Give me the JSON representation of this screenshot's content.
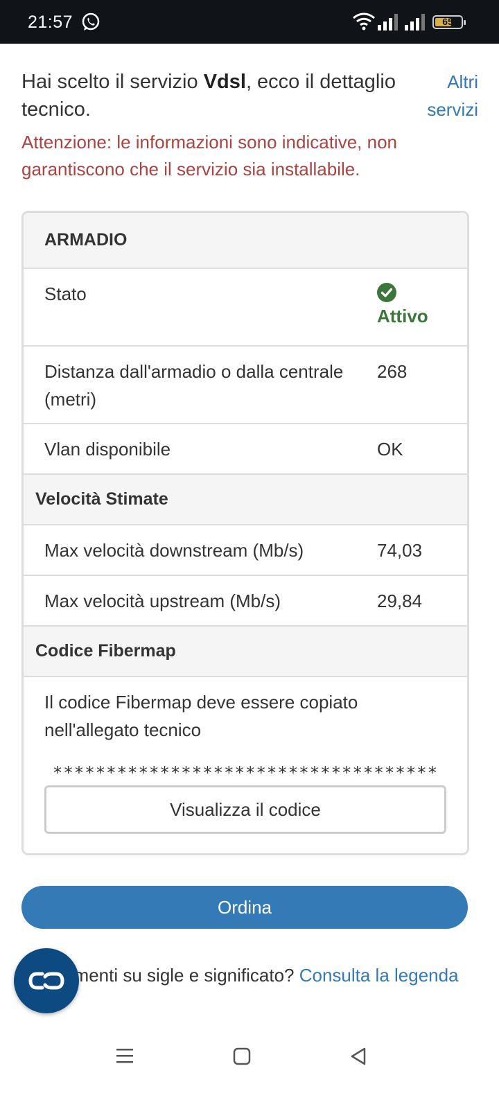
{
  "status_bar": {
    "time": "21:57",
    "battery": "65",
    "battery_level": 0.65,
    "icons": [
      "whatsapp-icon",
      "wifi-icon",
      "signal-icon",
      "signal-icon",
      "battery-icon"
    ]
  },
  "intro": {
    "prefix": "Hai scelto il servizio ",
    "service": "Vdsl",
    "suffix": ", ecco il dettaglio tecnico.",
    "altri_servizi": "Altri servizi",
    "warning": "Attenzione: le informazioni sono indicative, non garantiscono che il servizio sia installabile."
  },
  "panel": {
    "title": "ARMADIO",
    "rows": [
      {
        "label": "Stato",
        "value": "Attivo",
        "status_color": "#3c763d"
      },
      {
        "label": "Distanza dall'armadio o dalla centrale (metri)",
        "value": "268"
      },
      {
        "label": "Vlan disponibile",
        "value": "OK"
      }
    ],
    "speed_section": "Velocità Stimate",
    "speed_rows": [
      {
        "label": "Max velocità downstream (Mb/s)",
        "value": "74,03"
      },
      {
        "label": "Max velocità upstream (Mb/s)",
        "value": "29,84"
      }
    ],
    "fibermap_section": "Codice Fibermap",
    "fibermap_text": "Il codice Fibermap deve essere copiato nell'allegato tecnico",
    "fibermap_masked": "************************************",
    "view_button": "Visualizza il codice"
  },
  "order_button": "Ordina",
  "help": {
    "text": "chiarimenti su sigle e significato? ",
    "link": "Consulta la legenda"
  },
  "colors": {
    "accent": "#337ab7",
    "warning": "#a94442",
    "success": "#3c763d",
    "fab": "#0e4a82"
  }
}
